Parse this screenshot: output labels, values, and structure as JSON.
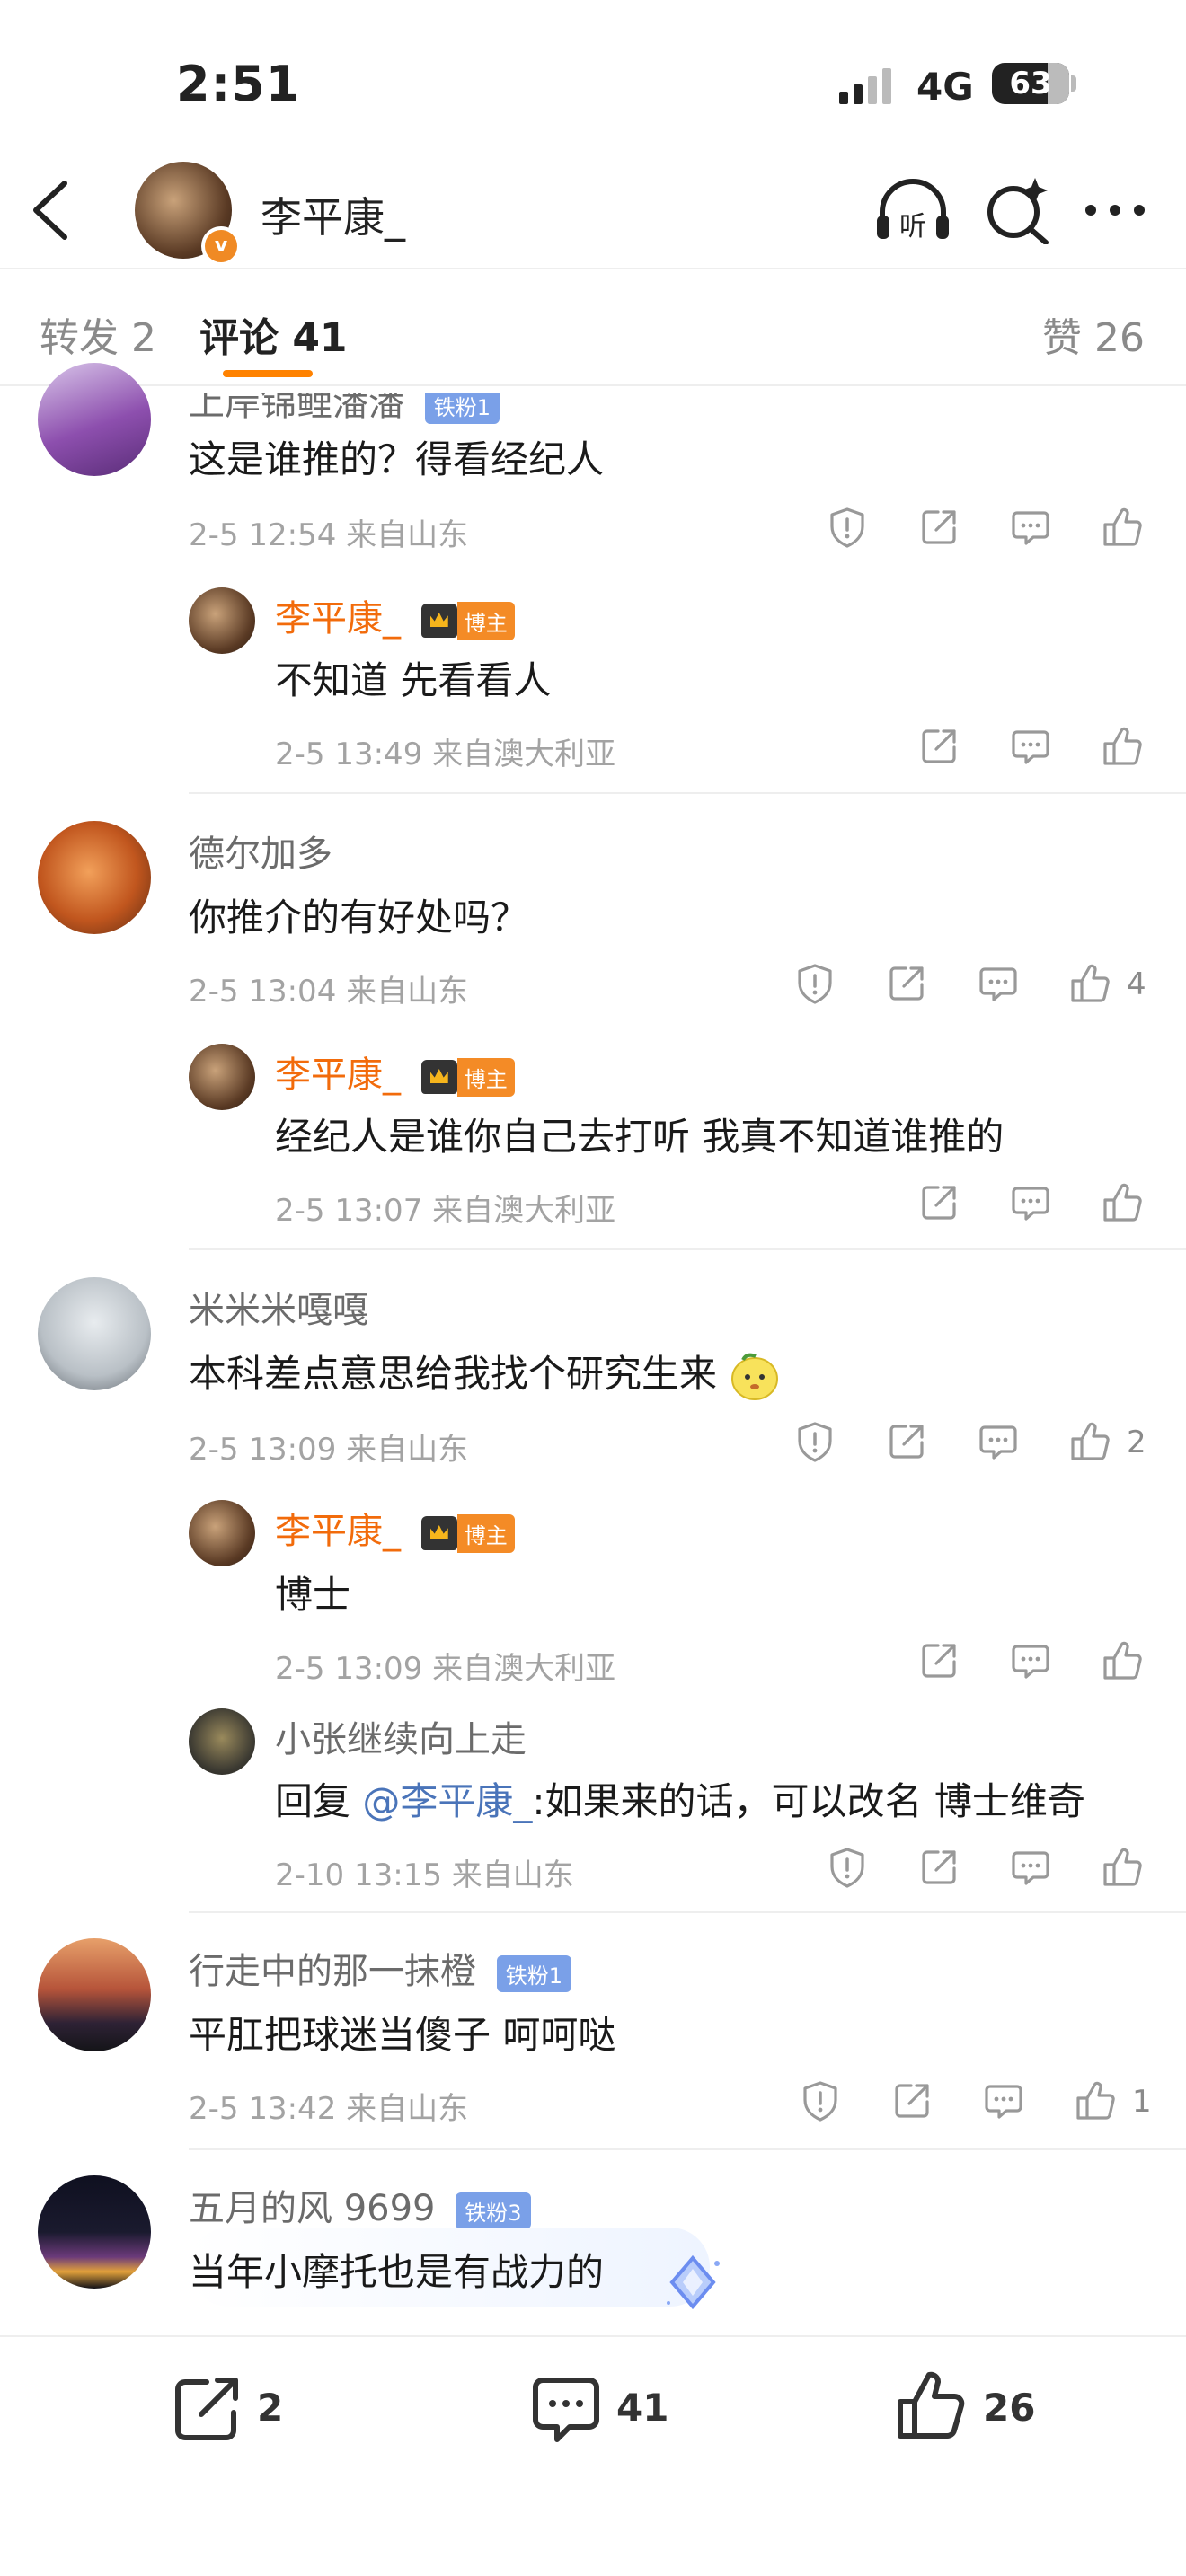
{
  "status_bar": {
    "time": "2:51",
    "network": "4G",
    "battery": "63"
  },
  "header": {
    "title": "李平康_"
  },
  "tabs": {
    "repost": "转发 2",
    "comments": "评论 41",
    "likes": "赞 26"
  },
  "comments": [
    {
      "user": "上岸锦鲤潘潘",
      "badge": "铁粉1",
      "text": "这是谁推的？得看经纪人",
      "meta": "2-5 12:54  来自山东"
    },
    {
      "user": "李平康_",
      "host_badge": "博主",
      "text": "不知道 先看看人",
      "meta": "2-5 13:49  来自澳大利亚"
    },
    {
      "user": "德尔加多",
      "text": "你推介的有好处吗？",
      "meta": "2-5 13:04  来自山东",
      "likes": "4"
    },
    {
      "user": "李平康_",
      "host_badge": "博主",
      "text": "经纪人是谁你自己去打听 我真不知道谁推的",
      "meta": "2-5 13:07  来自澳大利亚"
    },
    {
      "user": "米米米嘎嘎",
      "text": "本科差点意思给我找个研究生来",
      "meta": "2-5 13:09  来自山东",
      "likes": "2"
    },
    {
      "user": "李平康_",
      "host_badge": "博主",
      "text": "博士",
      "meta": "2-5 13:09  来自澳大利亚"
    },
    {
      "user": "小张继续向上走",
      "reply_prefix": "回复 ",
      "mention": "@李平康_",
      "text": ":如果来的话，可以改名 博士维奇",
      "meta": "2-10 13:15  来自山东"
    },
    {
      "user": "行走中的那一抹橙",
      "badge": "铁粉1",
      "text": "平肛把球迷当傻子 呵呵哒",
      "meta": "2-5 13:42  来自山东",
      "likes": "1"
    },
    {
      "user": "五月的风 9699",
      "badge": "铁粉3",
      "text": "当年小摩托也是有战力的"
    }
  ],
  "bottom_bar": {
    "reposts": "2",
    "comments": "41",
    "likes": "26"
  }
}
